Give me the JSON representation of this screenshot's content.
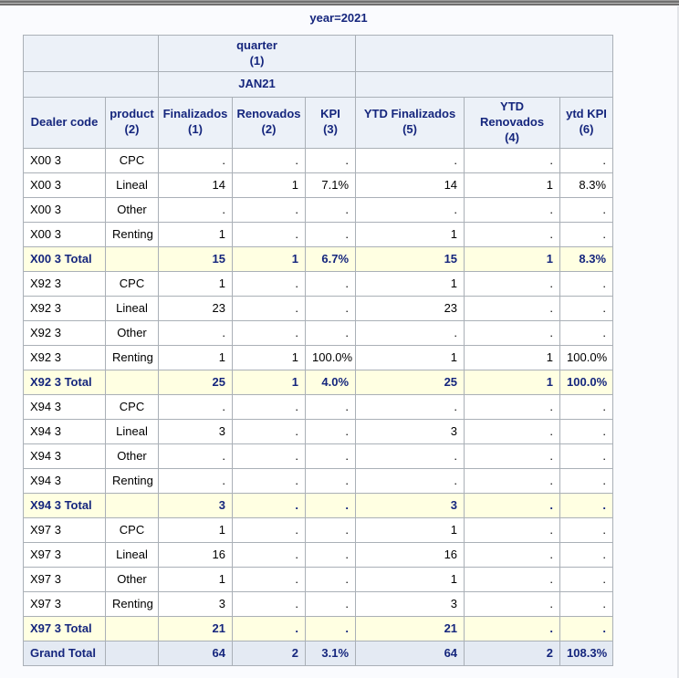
{
  "page": {
    "title": "year=2021",
    "colors": {
      "page_bg": "#fafbfe",
      "header_bg": "#ecf1f8",
      "header_text": "#15267d",
      "border": "#aab0b7",
      "total_row_bg": "#ffffe2",
      "grand_total_row_bg": "#e4eaf3",
      "data_text": "#000000",
      "top_bar": "#6f6f6f"
    }
  },
  "table": {
    "group_header": {
      "quarter": "quarter\n(1)",
      "month": "JAN21"
    },
    "columns": [
      "Dealer code",
      "product\n(2)",
      "Finalizados\n(1)",
      "Renovados\n(2)",
      "KPI\n(3)",
      "YTD Finalizados\n(5)",
      "YTD Renovados\n(4)",
      "ytd KPI\n(6)"
    ],
    "rows": [
      {
        "type": "data",
        "dealer": "X00 3",
        "product": "CPC",
        "values": [
          ".",
          ".",
          ".",
          ".",
          ".",
          "."
        ]
      },
      {
        "type": "data",
        "dealer": "X00 3",
        "product": "Lineal",
        "values": [
          "14",
          "1",
          "7.1%",
          "14",
          "1",
          "8.3%"
        ]
      },
      {
        "type": "data",
        "dealer": "X00 3",
        "product": "Other",
        "values": [
          ".",
          ".",
          ".",
          ".",
          ".",
          "."
        ]
      },
      {
        "type": "data",
        "dealer": "X00 3",
        "product": "Renting",
        "values": [
          "1",
          ".",
          ".",
          "1",
          ".",
          "."
        ]
      },
      {
        "type": "total",
        "dealer": "X00 3 Total",
        "product": "",
        "values": [
          "15",
          "1",
          "6.7%",
          "15",
          "1",
          "8.3%"
        ]
      },
      {
        "type": "data",
        "dealer": "X92 3",
        "product": "CPC",
        "values": [
          "1",
          ".",
          ".",
          "1",
          ".",
          "."
        ]
      },
      {
        "type": "data",
        "dealer": "X92 3",
        "product": "Lineal",
        "values": [
          "23",
          ".",
          ".",
          "23",
          ".",
          "."
        ]
      },
      {
        "type": "data",
        "dealer": "X92 3",
        "product": "Other",
        "values": [
          ".",
          ".",
          ".",
          ".",
          ".",
          "."
        ]
      },
      {
        "type": "data",
        "dealer": "X92 3",
        "product": "Renting",
        "values": [
          "1",
          "1",
          "100.0%",
          "1",
          "1",
          "100.0%"
        ]
      },
      {
        "type": "total",
        "dealer": "X92 3 Total",
        "product": "",
        "values": [
          "25",
          "1",
          "4.0%",
          "25",
          "1",
          "100.0%"
        ]
      },
      {
        "type": "data",
        "dealer": "X94 3",
        "product": "CPC",
        "values": [
          ".",
          ".",
          ".",
          ".",
          ".",
          "."
        ]
      },
      {
        "type": "data",
        "dealer": "X94 3",
        "product": "Lineal",
        "values": [
          "3",
          ".",
          ".",
          "3",
          ".",
          "."
        ]
      },
      {
        "type": "data",
        "dealer": "X94 3",
        "product": "Other",
        "values": [
          ".",
          ".",
          ".",
          ".",
          ".",
          "."
        ]
      },
      {
        "type": "data",
        "dealer": "X94 3",
        "product": "Renting",
        "values": [
          ".",
          ".",
          ".",
          ".",
          ".",
          "."
        ]
      },
      {
        "type": "total",
        "dealer": "X94 3 Total",
        "product": "",
        "values": [
          "3",
          ".",
          ".",
          "3",
          ".",
          "."
        ]
      },
      {
        "type": "data",
        "dealer": "X97 3",
        "product": "CPC",
        "values": [
          "1",
          ".",
          ".",
          "1",
          ".",
          "."
        ]
      },
      {
        "type": "data",
        "dealer": "X97 3",
        "product": "Lineal",
        "values": [
          "16",
          ".",
          ".",
          "16",
          ".",
          "."
        ]
      },
      {
        "type": "data",
        "dealer": "X97 3",
        "product": "Other",
        "values": [
          "1",
          ".",
          ".",
          "1",
          ".",
          "."
        ]
      },
      {
        "type": "data",
        "dealer": "X97 3",
        "product": "Renting",
        "values": [
          "3",
          ".",
          ".",
          "3",
          ".",
          "."
        ]
      },
      {
        "type": "total",
        "dealer": "X97 3 Total",
        "product": "",
        "values": [
          "21",
          ".",
          ".",
          "21",
          ".",
          "."
        ]
      },
      {
        "type": "grand",
        "dealer": "Grand Total",
        "product": "",
        "values": [
          "64",
          "2",
          "3.1%",
          "64",
          "2",
          "108.3%"
        ]
      }
    ]
  }
}
